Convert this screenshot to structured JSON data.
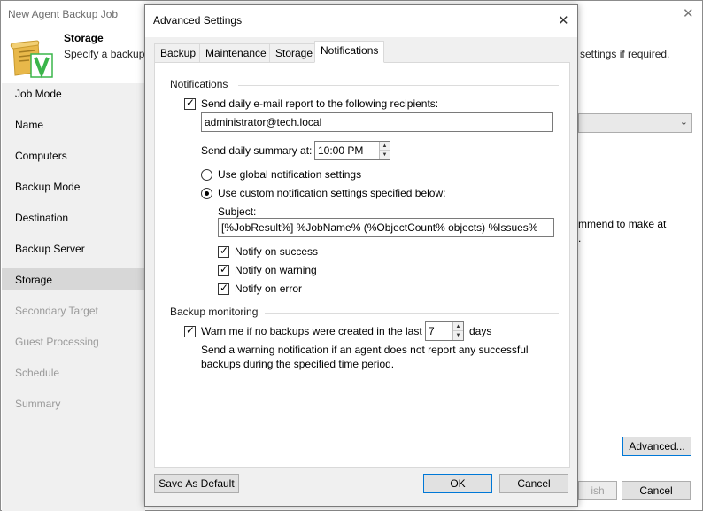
{
  "wizard": {
    "title": "New Agent Backup Job",
    "step_title": "Storage",
    "step_desc": "Specify a backup",
    "step_desc_right": "settings if required.",
    "right_text_1": "mmend to make at",
    "right_text_2": ".",
    "sidebar": [
      {
        "label": "Job Mode",
        "state": "normal"
      },
      {
        "label": "Name",
        "state": "normal"
      },
      {
        "label": "Computers",
        "state": "normal"
      },
      {
        "label": "Backup Mode",
        "state": "normal"
      },
      {
        "label": "Destination",
        "state": "normal"
      },
      {
        "label": "Backup Server",
        "state": "normal"
      },
      {
        "label": "Storage",
        "state": "selected"
      },
      {
        "label": "Secondary Target",
        "state": "disabled"
      },
      {
        "label": "Guest Processing",
        "state": "disabled"
      },
      {
        "label": "Schedule",
        "state": "disabled"
      },
      {
        "label": "Summary",
        "state": "disabled"
      }
    ],
    "buttons": {
      "advanced": "Advanced...",
      "finish": "ish",
      "cancel": "Cancel"
    }
  },
  "dialog": {
    "title": "Advanced Settings",
    "tabs": [
      {
        "label": "Backup",
        "active": false
      },
      {
        "label": "Maintenance",
        "active": false
      },
      {
        "label": "Storage",
        "active": false
      },
      {
        "label": "Notifications",
        "active": true
      }
    ],
    "notifications": {
      "group_label": "Notifications",
      "send_daily_label": "Send daily e-mail report to the following recipients:",
      "send_daily_checked": true,
      "recipients_value": "administrator@tech.local",
      "summary_at_label": "Send daily summary at:",
      "summary_time": "10:00 PM",
      "use_global_label": "Use global notification settings",
      "use_custom_label": "Use custom notification settings specified below:",
      "selected_option": "custom",
      "subject_label": "Subject:",
      "subject_value": "[%JobResult%] %JobName% (%ObjectCount% objects) %Issues%",
      "notify_success_label": "Notify on success",
      "notify_success_checked": true,
      "notify_warning_label": "Notify on warning",
      "notify_warning_checked": true,
      "notify_error_label": "Notify on error",
      "notify_error_checked": true
    },
    "monitoring": {
      "group_label": "Backup monitoring",
      "warn_label": "Warn me if no backups were created in the last",
      "warn_checked": true,
      "days_value": "7",
      "days_label": "days",
      "desc_line1": "Send a warning notification if an agent does not report any successful",
      "desc_line2": "backups during the specified time period."
    },
    "buttons": {
      "save_default": "Save As Default",
      "ok": "OK",
      "cancel": "Cancel"
    }
  },
  "colors": {
    "accent": "#0078d7",
    "sidebar_bg": "#f0f0f0",
    "sidebar_selected": "#d7d7d7",
    "icon_green": "#3ab54a",
    "icon_gold": "#e8b84a"
  }
}
